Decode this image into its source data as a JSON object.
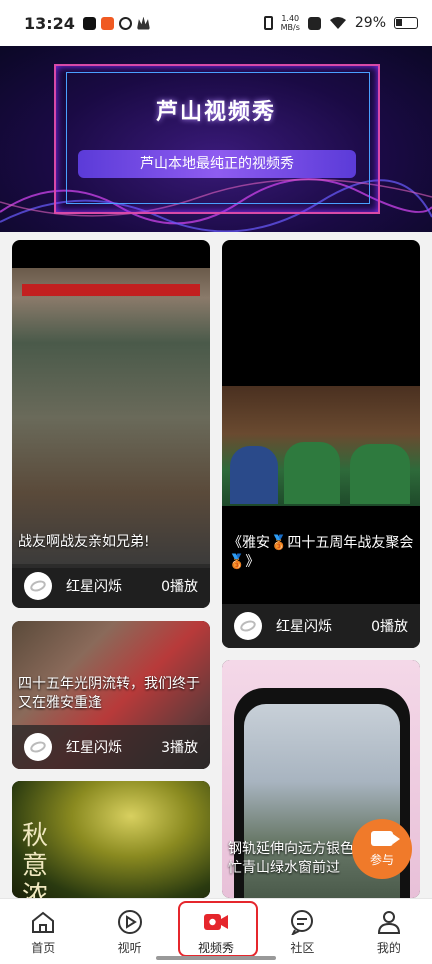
{
  "status_bar": {
    "time": "13:24",
    "net_speed_value": "1.40",
    "net_speed_unit": "MB/s",
    "battery": "29%"
  },
  "banner": {
    "title": "芦山视频秀",
    "subtitle": "芦山本地最纯正的视频秀"
  },
  "videos": [
    {
      "caption": "战友啊战友亲如兄弟!",
      "author": "红星闪烁",
      "plays": "0播放"
    },
    {
      "caption": "《雅安🥉四十五周年战友聚会🥉》",
      "author": "红星闪烁",
      "plays": "0播放"
    },
    {
      "caption": "四十五年光阴流转，我们终于又在雅安重逢",
      "author": "红星闪烁",
      "plays": "3播放"
    },
    {
      "caption": "秋意浓",
      "author": "",
      "plays": ""
    },
    {
      "caption": "钢轨延伸向远方银色长龙穿梭忙青山绿水窗前过",
      "author": "",
      "plays": ""
    }
  ],
  "fab": {
    "label": "参与"
  },
  "tabs": [
    {
      "label": "首页",
      "icon": "home-icon"
    },
    {
      "label": "视听",
      "icon": "play-circle-icon"
    },
    {
      "label": "视频秀",
      "icon": "video-camera-icon"
    },
    {
      "label": "社区",
      "icon": "chat-icon"
    },
    {
      "label": "我的",
      "icon": "person-icon"
    }
  ],
  "colors": {
    "accent": "#e5262c",
    "fab": "#f07a2a",
    "banner_bg": "#1a0a44"
  }
}
